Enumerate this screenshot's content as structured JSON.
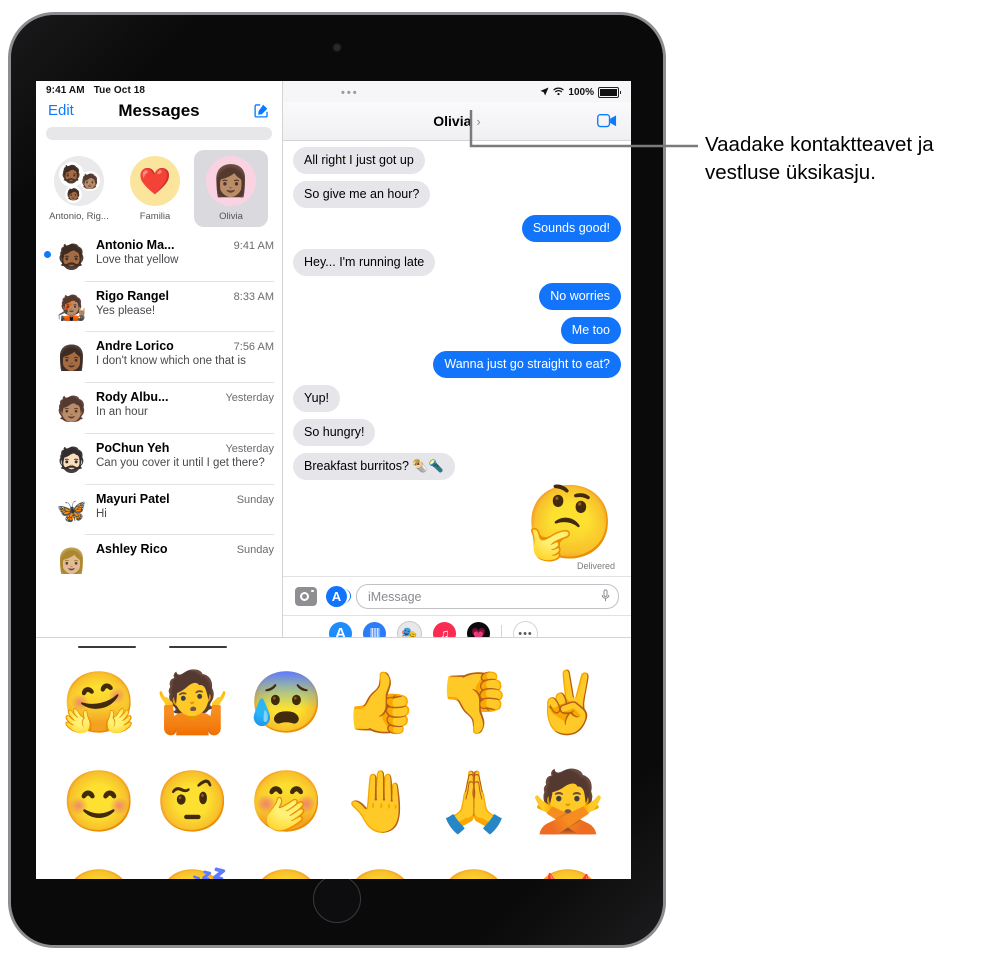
{
  "callout": {
    "text": "Vaadake kontaktteavet ja vestluse üksikasju."
  },
  "left_pane": {
    "status_bar": {
      "time": "9:41 AM",
      "date": "Tue Oct 18"
    },
    "nav": {
      "edit_label": "Edit",
      "title": "Messages",
      "compose_icon": "compose-icon"
    },
    "search_placeholder": "",
    "pinned": [
      {
        "label": "Antonio, Rig...",
        "avatar_icon": "group-memoji-avatar",
        "selected": false
      },
      {
        "label": "Familia",
        "avatar_icon": "heart-emoji",
        "glyph": "❤️",
        "selected": false
      },
      {
        "label": "Olivia",
        "avatar_icon": "olivia-memoji",
        "glyph": "👩🏽",
        "selected": true
      }
    ],
    "conversations": [
      {
        "name": "Antonio Ma...",
        "time": "9:41 AM",
        "preview": "Love that yellow",
        "unread": true,
        "avatar_glyph": "🧔🏾"
      },
      {
        "name": "Rigo Rangel",
        "time": "8:33 AM",
        "preview": "Yes please!",
        "unread": false,
        "avatar_glyph": "🧑🏽‍🎤"
      },
      {
        "name": "Andre Lorico",
        "time": "7:56 AM",
        "preview": "I don't know which one that is",
        "unread": false,
        "avatar_glyph": "👩🏾"
      },
      {
        "name": "Rody Albu...",
        "time": "Yesterday",
        "preview": "In an hour",
        "unread": false,
        "avatar_glyph": "🧑🏽"
      },
      {
        "name": "PoChun Yeh",
        "time": "Yesterday",
        "preview": "Can you cover it until I get there?",
        "unread": false,
        "avatar_glyph": "🧔🏻"
      },
      {
        "name": "Mayuri Patel",
        "time": "Sunday",
        "preview": "Hi",
        "unread": false,
        "avatar_glyph": "🦋"
      },
      {
        "name": "Ashley Rico",
        "time": "Sunday",
        "preview": "",
        "unread": false,
        "avatar_glyph": "👩🏼"
      }
    ]
  },
  "right_pane": {
    "status_bar": {
      "dots": "•••",
      "location_icon": "location-arrow-icon",
      "wifi_icon": "wifi-icon",
      "battery_percent": "100%",
      "battery_icon": "battery-full-icon"
    },
    "nav": {
      "title": "Olivia",
      "chevron": "›",
      "facetime_icon": "facetime-video-icon"
    },
    "messages": [
      {
        "side": "in",
        "text": "All right I just got up",
        "tail": false
      },
      {
        "side": "in",
        "text": "So give me an hour?",
        "tail": true
      },
      {
        "side": "out",
        "text": "Sounds good!",
        "tail": true
      },
      {
        "side": "in",
        "text": "Hey... I'm running late",
        "tail": true
      },
      {
        "side": "out",
        "text": "No worries",
        "tail": false
      },
      {
        "side": "out",
        "text": "Me too",
        "tail": false
      },
      {
        "side": "out",
        "text": "Wanna just go straight to eat?",
        "tail": true
      },
      {
        "side": "in",
        "text": "Yup!",
        "tail": false
      },
      {
        "side": "in",
        "text": "So hungry!",
        "tail": false
      },
      {
        "side": "in",
        "text": "Breakfast burritos? 🌯🔦",
        "tail": true
      }
    ],
    "sticker_message": {
      "glyph": "🤔",
      "status": "Delivered"
    },
    "input_bar": {
      "camera_icon": "camera-icon",
      "appstore_icon": "app-store-icon",
      "placeholder": "iMessage",
      "value": "",
      "mic_icon": "microphone-icon"
    },
    "app_drawer": {
      "items": [
        {
          "name": "photos-app-icon",
          "glyph": "❀"
        },
        {
          "name": "app-store-icon",
          "glyph": "A"
        },
        {
          "name": "audio-message-icon",
          "glyph": "⦀⦀"
        },
        {
          "name": "memoji-stickers-icon",
          "glyph": "🎭"
        },
        {
          "name": "music-app-icon",
          "glyph": "♫"
        },
        {
          "name": "fitness-app-icon",
          "glyph": "💗"
        }
      ],
      "more_label": "•••"
    }
  },
  "sticker_drawer": {
    "handle_icon": "drag-handle",
    "tabs": [
      "",
      ""
    ],
    "stickers": [
      "🤗",
      "🤷",
      "😰",
      "👍",
      "👎",
      "✌️",
      "😊",
      "🤨",
      "🤭",
      "🤚",
      "🙏",
      "🙅",
      "😌",
      "😴",
      "😆",
      "😋",
      "😎",
      "🤩"
    ]
  }
}
